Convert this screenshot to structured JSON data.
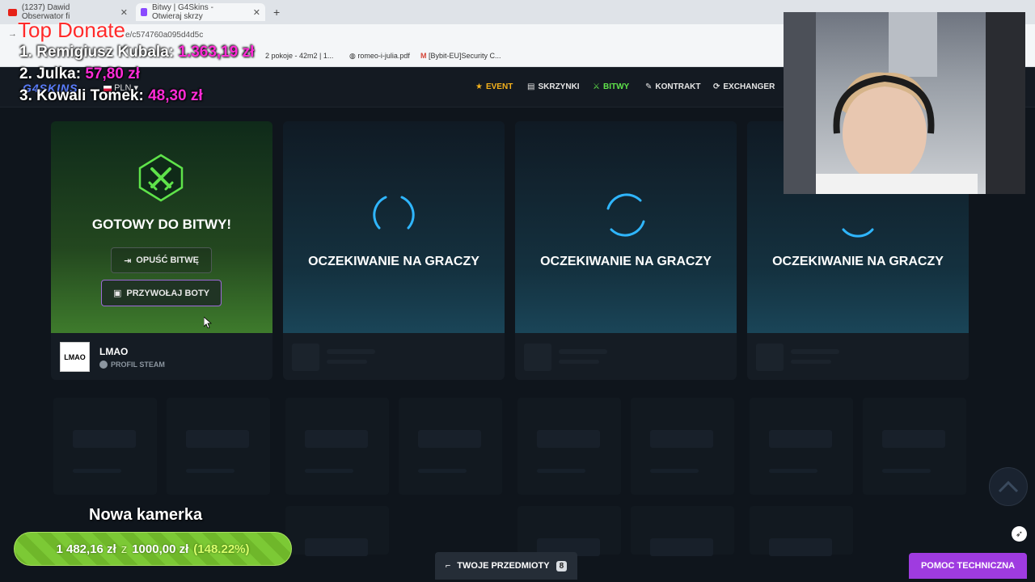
{
  "browser": {
    "tabs": [
      {
        "label": "(1237) Dawid Obserwator fi"
      },
      {
        "label": "Bitwy | G4Skins - Otwieraj skrzy"
      }
    ],
    "url": "e/c574760a095d4d5c",
    "bookmarks": [
      "2 pokoje - 42m2 | 1...",
      "romeo-i-julia.pdf",
      "[Bybit-EU]Security C..."
    ]
  },
  "overlay": {
    "donate_title": "Top Donate",
    "donors": [
      {
        "name": "1. Remigiusz Kubala:",
        "amount": "1.363,19 zł"
      },
      {
        "name": "2. Julka:",
        "amount": "57,80 zł"
      },
      {
        "name": "3. Kowali Tomek:",
        "amount": "48,30 zł"
      }
    ],
    "camera_title": "Nowa kamerka",
    "goal": {
      "current": "1 482,16 zł",
      "of": "z",
      "target": "1000,00 zł",
      "percent": "(148.22%)"
    }
  },
  "site": {
    "logo": "G4SKINS",
    "currency": "PLN",
    "nav": [
      {
        "label": "EVENT",
        "icon": "star-icon",
        "color": "#f5b21c"
      },
      {
        "label": "SKRZYNKI",
        "icon": "crates-icon",
        "color": "#e6e6e6"
      },
      {
        "label": "BITWY",
        "icon": "battle-icon",
        "color": "#5fe34a"
      },
      {
        "label": "KONTRAKT",
        "icon": "pen-icon",
        "color": "#e6e6e6"
      },
      {
        "label": "EXCHANGER",
        "icon": "exchange-icon",
        "color": "#e6e6e6"
      }
    ]
  },
  "battle": {
    "ready_title": "GOTOWY DO BITWY!",
    "leave_label": "OPUŚĆ BITWĘ",
    "bots_label": "PRZYWOŁAJ BOTY",
    "waiting_label": "OCZEKIWANIE NA GRACZY",
    "player": {
      "avatar_text": "LMAO",
      "name": "LMAO",
      "profile": "PROFIL STEAM"
    }
  },
  "footer": {
    "items_label": "TWOJE PRZEDMIOTY",
    "items_count": "8",
    "help_label": "POMOC TECHNICZNA"
  },
  "colors": {
    "accent_green": "#5fe34a",
    "accent_purple": "#9f3be0",
    "spinner_blue": "#2fb6ff"
  }
}
